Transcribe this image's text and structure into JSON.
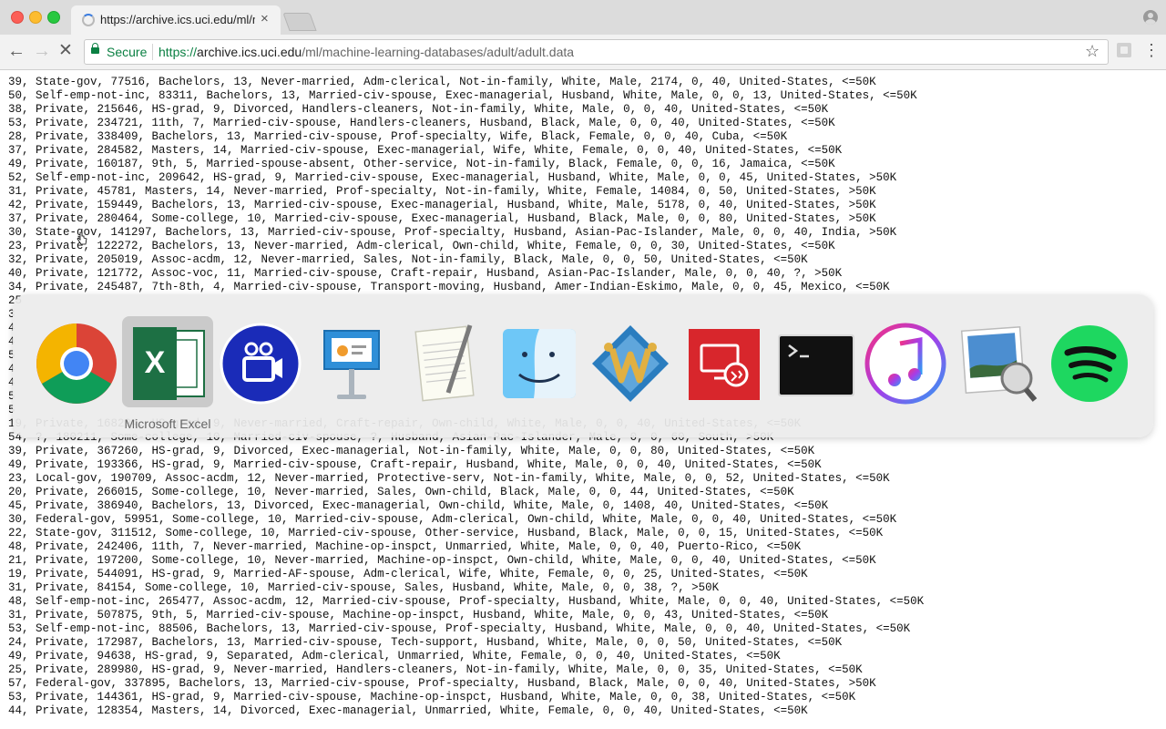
{
  "browser": {
    "tab_title": "https://archive.ics.uci.edu/ml/m",
    "tab_close": "×",
    "secure_label": "Secure",
    "url_scheme": "https://",
    "url_host": "archive.ics.uci.edu",
    "url_path": "/ml/machine-learning-databases/adult/adult.data",
    "back_glyph": "←",
    "forward_glyph": "→",
    "stop_glyph": "✕",
    "star_glyph": "☆",
    "menu_glyph": "⋮",
    "url_color": "#0b8043",
    "accent_blue": "#3b7de0"
  },
  "data_lines": [
    "39, State-gov, 77516, Bachelors, 13, Never-married, Adm-clerical, Not-in-family, White, Male, 2174, 0, 40, United-States, <=50K",
    "50, Self-emp-not-inc, 83311, Bachelors, 13, Married-civ-spouse, Exec-managerial, Husband, White, Male, 0, 0, 13, United-States, <=50K",
    "38, Private, 215646, HS-grad, 9, Divorced, Handlers-cleaners, Not-in-family, White, Male, 0, 0, 40, United-States, <=50K",
    "53, Private, 234721, 11th, 7, Married-civ-spouse, Handlers-cleaners, Husband, Black, Male, 0, 0, 40, United-States, <=50K",
    "28, Private, 338409, Bachelors, 13, Married-civ-spouse, Prof-specialty, Wife, Black, Female, 0, 0, 40, Cuba, <=50K",
    "37, Private, 284582, Masters, 14, Married-civ-spouse, Exec-managerial, Wife, White, Female, 0, 0, 40, United-States, <=50K",
    "49, Private, 160187, 9th, 5, Married-spouse-absent, Other-service, Not-in-family, Black, Female, 0, 0, 16, Jamaica, <=50K",
    "52, Self-emp-not-inc, 209642, HS-grad, 9, Married-civ-spouse, Exec-managerial, Husband, White, Male, 0, 0, 45, United-States, >50K",
    "31, Private, 45781, Masters, 14, Never-married, Prof-specialty, Not-in-family, White, Female, 14084, 0, 50, United-States, >50K",
    "42, Private, 159449, Bachelors, 13, Married-civ-spouse, Exec-managerial, Husband, White, Male, 5178, 0, 40, United-States, >50K",
    "37, Private, 280464, Some-college, 10, Married-civ-spouse, Exec-managerial, Husband, Black, Male, 0, 0, 80, United-States, >50K",
    "30, State-gov, 141297, Bachelors, 13, Married-civ-spouse, Prof-specialty, Husband, Asian-Pac-Islander, Male, 0, 0, 40, India, >50K",
    "23, Private, 122272, Bachelors, 13, Never-married, Adm-clerical, Own-child, White, Female, 0, 0, 30, United-States, <=50K",
    "32, Private, 205019, Assoc-acdm, 12, Never-married, Sales, Not-in-family, Black, Male, 0, 0, 50, United-States, <=50K",
    "40, Private, 121772, Assoc-voc, 11, Married-civ-spouse, Craft-repair, Husband, Asian-Pac-Islander, Male, 0, 0, 40, ?, >50K",
    "34, Private, 245487, 7th-8th, 4, Married-civ-spouse, Transport-moving, Husband, Amer-Indian-Eskimo, Male, 0, 0, 45, Mexico, <=50K",
    "25",
    "3",
    "4",
    "4",
    "5",
    "4",
    "4",
    "5",
    "5",
    "19, Private, 168294, HS-grad, 9, Never-married, Craft-repair, Own-child, White, Male, 0, 0, 40, United-States, <=50K",
    "54, ?, 180211, Some-college, 10, Married-civ-spouse, ?, Husband, Asian-Pac-Islander, Male, 0, 0, 60, South, >50K",
    "39, Private, 367260, HS-grad, 9, Divorced, Exec-managerial, Not-in-family, White, Male, 0, 0, 80, United-States, <=50K",
    "49, Private, 193366, HS-grad, 9, Married-civ-spouse, Craft-repair, Husband, White, Male, 0, 0, 40, United-States, <=50K",
    "23, Local-gov, 190709, Assoc-acdm, 12, Never-married, Protective-serv, Not-in-family, White, Male, 0, 0, 52, United-States, <=50K",
    "20, Private, 266015, Some-college, 10, Never-married, Sales, Own-child, Black, Male, 0, 0, 44, United-States, <=50K",
    "45, Private, 386940, Bachelors, 13, Divorced, Exec-managerial, Own-child, White, Male, 0, 1408, 40, United-States, <=50K",
    "30, Federal-gov, 59951, Some-college, 10, Married-civ-spouse, Adm-clerical, Own-child, White, Male, 0, 0, 40, United-States, <=50K",
    "22, State-gov, 311512, Some-college, 10, Married-civ-spouse, Other-service, Husband, Black, Male, 0, 0, 15, United-States, <=50K",
    "48, Private, 242406, 11th, 7, Never-married, Machine-op-inspct, Unmarried, White, Male, 0, 0, 40, Puerto-Rico, <=50K",
    "21, Private, 197200, Some-college, 10, Never-married, Machine-op-inspct, Own-child, White, Male, 0, 0, 40, United-States, <=50K",
    "19, Private, 544091, HS-grad, 9, Married-AF-spouse, Adm-clerical, Wife, White, Female, 0, 0, 25, United-States, <=50K",
    "31, Private, 84154, Some-college, 10, Married-civ-spouse, Sales, Husband, White, Male, 0, 0, 38, ?, >50K",
    "48, Self-emp-not-inc, 265477, Assoc-acdm, 12, Married-civ-spouse, Prof-specialty, Husband, White, Male, 0, 0, 40, United-States, <=50K",
    "31, Private, 507875, 9th, 5, Married-civ-spouse, Machine-op-inspct, Husband, White, Male, 0, 0, 43, United-States, <=50K",
    "53, Self-emp-not-inc, 88506, Bachelors, 13, Married-civ-spouse, Prof-specialty, Husband, White, Male, 0, 0, 40, United-States, <=50K",
    "24, Private, 172987, Bachelors, 13, Married-civ-spouse, Tech-support, Husband, White, Male, 0, 0, 50, United-States, <=50K",
    "49, Private, 94638, HS-grad, 9, Separated, Adm-clerical, Unmarried, White, Female, 0, 0, 40, United-States, <=50K",
    "25, Private, 289980, HS-grad, 9, Never-married, Handlers-cleaners, Not-in-family, White, Male, 0, 0, 35, United-States, <=50K",
    "57, Federal-gov, 337895, Bachelors, 13, Married-civ-spouse, Prof-specialty, Husband, Black, Male, 0, 0, 40, United-States, >50K",
    "53, Private, 144361, HS-grad, 9, Married-civ-spouse, Machine-op-inspct, Husband, White, Male, 0, 0, 38, United-States, <=50K",
    "44, Private, 128354, Masters, 14, Divorced, Exec-managerial, Unmarried, White, Female, 0, 0, 40, United-States, <=50K"
  ],
  "app_switcher": {
    "selected_label": "Microsoft Excel",
    "apps": [
      {
        "icon": "chrome-icon"
      },
      {
        "icon": "excel-icon"
      },
      {
        "icon": "screencast-icon"
      },
      {
        "icon": "keynote-icon"
      },
      {
        "icon": "textedit-icon"
      },
      {
        "icon": "finder-icon"
      },
      {
        "icon": "mathematica-icon"
      },
      {
        "icon": "remote-desktop-icon"
      },
      {
        "icon": "terminal-icon"
      },
      {
        "icon": "itunes-icon"
      },
      {
        "icon": "preview-icon"
      },
      {
        "icon": "spotify-icon"
      }
    ]
  }
}
